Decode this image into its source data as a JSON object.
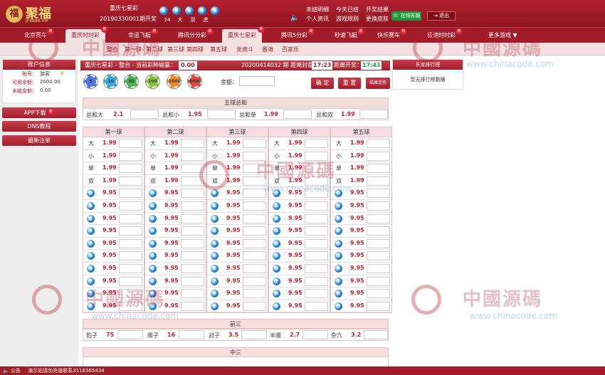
{
  "header": {
    "logo_text": "聚福",
    "logo_sub": "JF8888.VIP",
    "lottery_name": "重庆七星彩",
    "period_label": "20190330001期开奖",
    "result_balls": [
      "2",
      "3",
      "6",
      "5",
      "8"
    ],
    "result_summary": [
      "24",
      "大",
      "双",
      "虎"
    ],
    "links_row1": [
      "未结明细",
      "今天已结",
      "开奖结果"
    ],
    "links_row2": [
      "个人资讯",
      "游戏规则",
      "更换皮肤"
    ],
    "cs_label": "在线客服",
    "exit_label": "退出"
  },
  "nav": {
    "items": [
      {
        "label": "北京赛车",
        "badge": "新"
      },
      {
        "label": "重庆时时彩",
        "badge": "新"
      },
      {
        "label": "幸运飞艇",
        "badge": "新"
      },
      {
        "label": "腾讯分分彩",
        "badge": "新"
      },
      {
        "label": "重庆七星彩",
        "badge": "新"
      },
      {
        "label": "腾讯5分彩",
        "badge": "新"
      },
      {
        "label": "秒速飞艇",
        "badge": "新"
      },
      {
        "label": "快乐赛车",
        "badge": "新"
      },
      {
        "label": "极速时时彩",
        "badge": "新"
      },
      {
        "label": "更多游戏 ▼",
        "badge": ""
      }
    ],
    "sub_items": [
      "整合",
      "第一球",
      "第二球",
      "第三球",
      "第四球",
      "第五球",
      "龙虎斗",
      "番滩",
      "百家乐"
    ]
  },
  "sidebar": {
    "account_title": "账户信息",
    "rows": [
      {
        "k": "账号：",
        "v": "游客"
      },
      {
        "k": "可用余额：",
        "v": "2000.00"
      },
      {
        "k": "未结金额：",
        "v": "0.00"
      }
    ],
    "app_btn": "APP下载",
    "dns_btn": "DNS教程",
    "notice_btn": "最新注单"
  },
  "info": {
    "title": "重庆七星彩 - 整合 - 当前彩种输赢：",
    "pnl": "0.00",
    "period": "20200414032 期 距离封盘：",
    "close_time": "17:23",
    "draw_label": "距离开奖：",
    "draw_time": "17:43"
  },
  "chips": [
    "5",
    "10",
    "50",
    "100",
    "1000",
    "5000"
  ],
  "bet": {
    "amount_label": "金额：",
    "confirm": "确 定",
    "reset": "重 置",
    "trend": "结果走势"
  },
  "rank": {
    "title": "长龙排行榜",
    "empty": "暂无排行榜数据"
  },
  "sum_section": {
    "title": "五球总和",
    "items": [
      {
        "label": "总和大",
        "odds": "2.1"
      },
      {
        "label": "总和小",
        "odds": "1.95"
      },
      {
        "label": "总和单",
        "odds": "1.99"
      },
      {
        "label": "总和双",
        "odds": "1.99"
      }
    ]
  },
  "ball_columns": [
    "第一球",
    "第二球",
    "第三球",
    "第四球",
    "第五球"
  ],
  "ball_rows": [
    {
      "type": "text",
      "label": "大",
      "odds": "1.99"
    },
    {
      "type": "text",
      "label": "小",
      "odds": "1.99"
    },
    {
      "type": "text",
      "label": "单",
      "odds": "1.99"
    },
    {
      "type": "text",
      "label": "双",
      "odds": "1.99"
    },
    {
      "type": "ball",
      "label": "0",
      "odds": "9.95"
    },
    {
      "type": "ball",
      "label": "1",
      "odds": "9.95"
    },
    {
      "type": "ball",
      "label": "2",
      "odds": "9.95"
    },
    {
      "type": "ball",
      "label": "3",
      "odds": "9.95"
    },
    {
      "type": "ball",
      "label": "4",
      "odds": "9.95"
    },
    {
      "type": "ball",
      "label": "5",
      "odds": "9.95"
    },
    {
      "type": "ball",
      "label": "6",
      "odds": "9.95"
    },
    {
      "type": "ball",
      "label": "7",
      "odds": "9.95"
    },
    {
      "type": "ball",
      "label": "8",
      "odds": "9.95"
    },
    {
      "type": "ball",
      "label": "9",
      "odds": "9.95"
    }
  ],
  "front3": {
    "title": "前三",
    "items": [
      {
        "label": "豹子",
        "odds": "75"
      },
      {
        "label": "顺子",
        "odds": "16"
      },
      {
        "label": "对子",
        "odds": "3.5"
      },
      {
        "label": "半顺",
        "odds": "2.7"
      },
      {
        "label": "杂六",
        "odds": "3.2"
      }
    ]
  },
  "mid3": {
    "title": "中三"
  },
  "footer": {
    "label": "公告",
    "text": "演示站请勿充值联系3118365434"
  },
  "watermark": {
    "text": "中國源碼",
    "url": "www.chinacode.com"
  }
}
